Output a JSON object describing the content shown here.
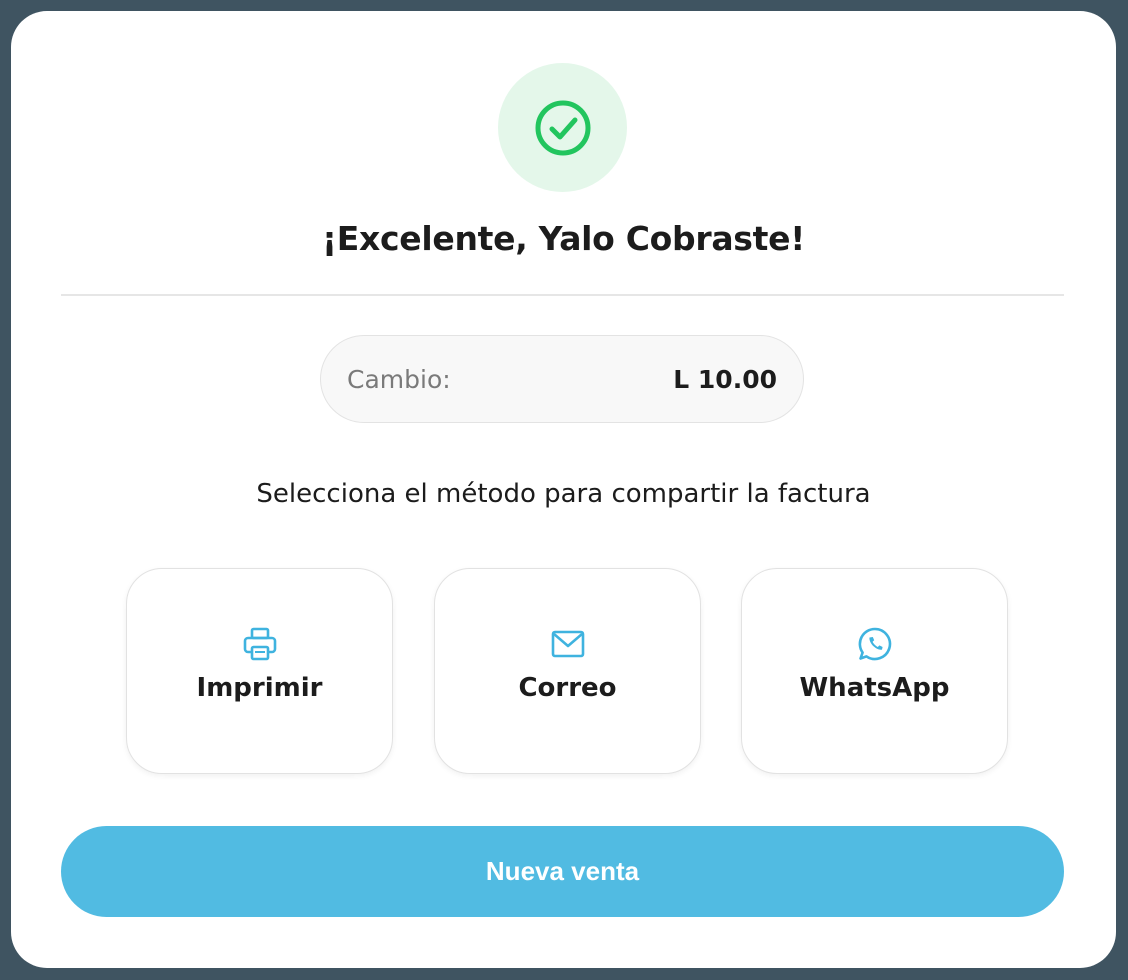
{
  "modal": {
    "title": "¡Excelente, Yalo Cobraste!",
    "success_icon": "check-circle-icon",
    "colors": {
      "success": "#22c55e",
      "success_bg": "#e4f7ea",
      "accent": "#51bbe2",
      "icon": "#3fb3df"
    }
  },
  "change": {
    "label": "Cambio:",
    "value": "L 10.00"
  },
  "share": {
    "instruction": "Selecciona el método para compartir la factura",
    "options": [
      {
        "label": "Imprimir",
        "icon": "printer-icon"
      },
      {
        "label": "Correo",
        "icon": "mail-icon"
      },
      {
        "label": "WhatsApp",
        "icon": "whatsapp-icon"
      }
    ]
  },
  "actions": {
    "new_sale_label": "Nueva venta"
  }
}
